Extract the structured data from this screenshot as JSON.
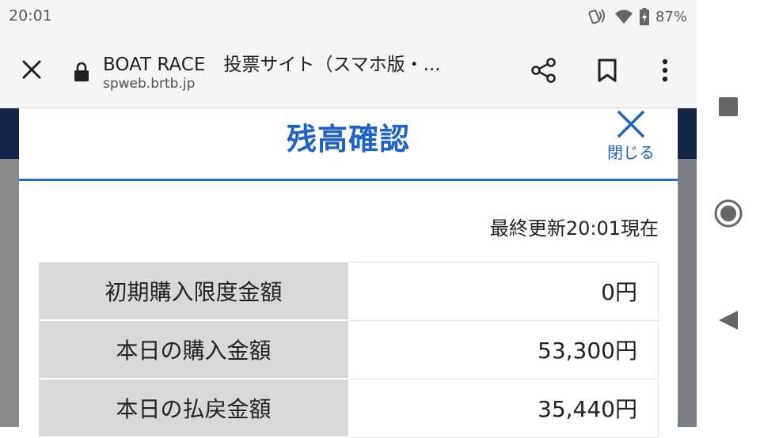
{
  "status_bar": {
    "time": "20:01",
    "battery": "87%",
    "icons": [
      "nfc-phone-icon",
      "wifi-icon",
      "battery-charging-icon"
    ]
  },
  "browser": {
    "page_title": "BOAT RACE　投票サイト（スマホ版・...",
    "url": "spweb.brtb.jp",
    "icons": [
      "close-icon",
      "lock-icon",
      "share-icon",
      "bookmark-icon",
      "more-vert-icon"
    ]
  },
  "dialog": {
    "title": "残高確認",
    "close_label": "閉じる",
    "updated": "最終更新20:01現在",
    "rows": [
      {
        "label": "初期購入限度金額",
        "value": "0円"
      },
      {
        "label": "本日の購入金額",
        "value": "53,300円"
      },
      {
        "label": "本日の払戻金額",
        "value": "35,440円"
      }
    ]
  },
  "nav_bar": {
    "icons": [
      "recents-square-icon",
      "home-circle-icon",
      "back-triangle-icon"
    ]
  },
  "colors": {
    "accent_blue": "#1f63c9",
    "header_navy": "#132547",
    "label_gray": "#d9d9d9"
  }
}
